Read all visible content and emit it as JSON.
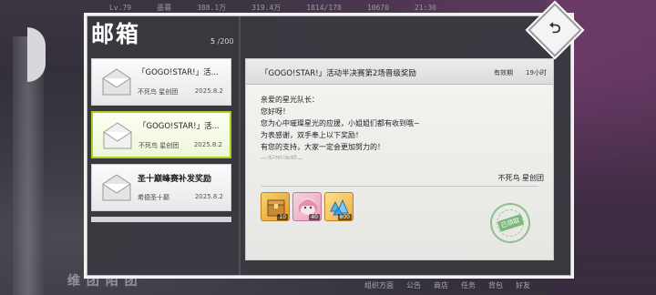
{
  "hud": {
    "level": "Lv.79",
    "player_name": "墨暮",
    "stat_1": "388.1万",
    "stat_2": "319.4万",
    "stamina": "1814/178",
    "currency": "10670",
    "clock": "21:30"
  },
  "mailbox": {
    "title": "邮箱",
    "count_current": "5",
    "count_total": "/200"
  },
  "mail_list": [
    {
      "title": "「GOGO!STAR!」活...",
      "sender": "不死鸟 星创团",
      "date": "2025.8.2",
      "selected": false
    },
    {
      "title": "「GOGO!STAR!」活...",
      "sender": "不死鸟 星创团",
      "date": "2025.8.2",
      "selected": true
    },
    {
      "title": "圣十巅峰赛补发奖励",
      "sender": "希德圣十巅",
      "date": "2025.8.2",
      "selected": false
    }
  ],
  "detail": {
    "title": "「GOGO!STAR!」活动半决赛第2场晋级奖励",
    "expire_label": "有效期",
    "expire_value": "19小时",
    "body": [
      "亲爱的星光队长：",
      "您好呀！",
      "您为心中璀璨星光的应援，小姐姐们都有收到哦~",
      "为表感谢，双手奉上以下奖励！",
      "有您的支持，大家一定会更加努力的！",
      "一起加油吧~"
    ],
    "signature": "不死鸟 星创团",
    "rewards": [
      {
        "icon": "treasure-box-icon",
        "qty": "10"
      },
      {
        "icon": "character-avatar-icon",
        "qty": "40"
      },
      {
        "icon": "blue-crystal-icon",
        "qty": "800"
      }
    ],
    "claimed_stamp": "已领取"
  },
  "bottom_hud": [
    "组织方面",
    "公告",
    "商店",
    "任务",
    "背包",
    "好友"
  ],
  "bottom_left_text": "维 团 陌 团",
  "colors": {
    "panel_bg": "#3a383f",
    "selected_border": "#a8d22a",
    "stamp_green": "#7cb87c"
  }
}
